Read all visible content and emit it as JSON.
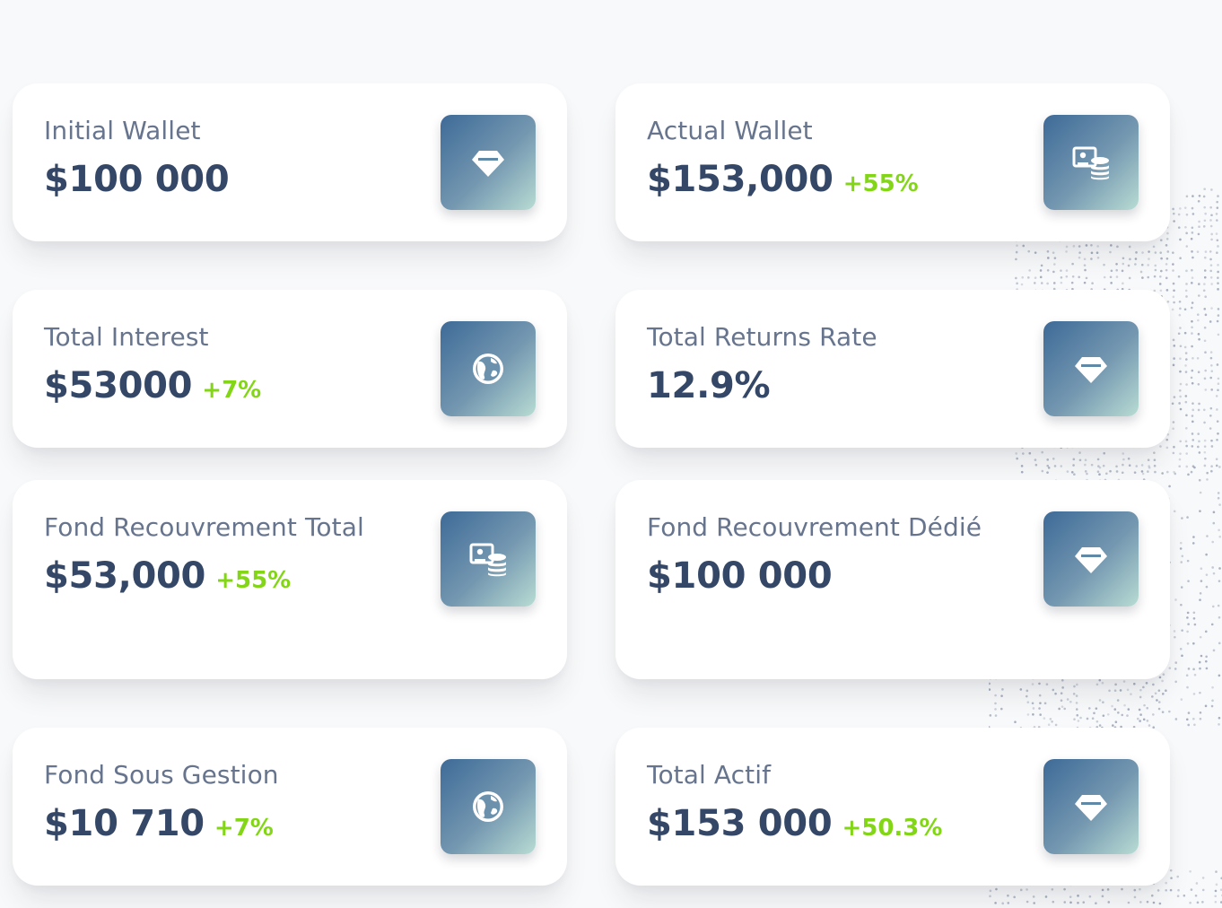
{
  "cards": [
    {
      "label": "Initial Wallet",
      "value": "$100 000",
      "change": "",
      "icon": "diamond-icon"
    },
    {
      "label": "Actual Wallet",
      "value": "$153,000",
      "change": "+55%",
      "icon": "money-coins-icon"
    },
    {
      "label": "Total Interest",
      "value": "$53000",
      "change": "+7%",
      "icon": "globe-icon"
    },
    {
      "label": "Total Returns Rate",
      "value": "12.9%",
      "change": "",
      "icon": "diamond-icon"
    },
    {
      "label": "Fond Recouvrement Total",
      "value": "$53,000",
      "change": "+55%",
      "icon": "money-coins-icon"
    },
    {
      "label": "Fond Recouvrement Dédié",
      "value": "$100 000",
      "change": "",
      "icon": "diamond-icon"
    },
    {
      "label": "Fond Sous Gestion",
      "value": "$10 710",
      "change": "+7%",
      "icon": "globe-icon"
    },
    {
      "label": "Total Actif",
      "value": "$153 000",
      "change": "+50.3%",
      "icon": "diamond-icon"
    }
  ],
  "colors": {
    "label": "#67748e",
    "value": "#344767",
    "positive_change": "#82d616",
    "icon_gradient_start": "#3d6a97",
    "icon_gradient_end": "#b8dcd3"
  }
}
